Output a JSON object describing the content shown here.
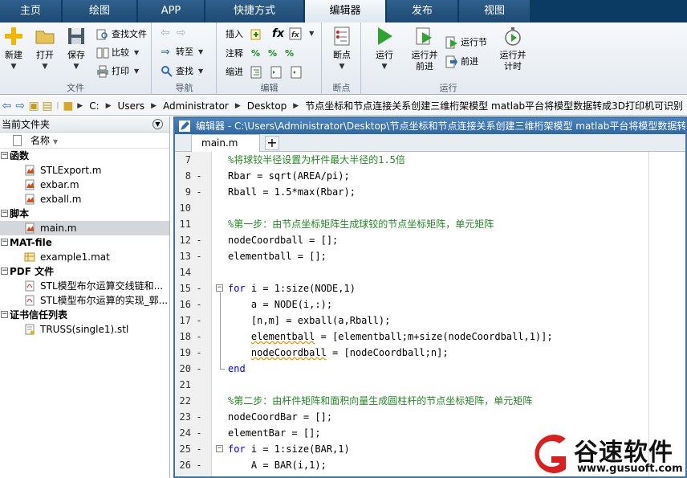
{
  "tabs": [
    {
      "label": "主页",
      "active": false
    },
    {
      "label": "绘图",
      "active": false
    },
    {
      "label": "APP",
      "active": false
    },
    {
      "label": "快捷方式",
      "active": false
    },
    {
      "label": "编辑器",
      "active": true
    },
    {
      "label": "发布",
      "active": false
    },
    {
      "label": "视图",
      "active": false
    }
  ],
  "ribbon": {
    "file": {
      "label": "文件",
      "new": "新建",
      "open": "打开",
      "save": "保存",
      "find_files": "查找文件",
      "compare": "比较",
      "print": "打印"
    },
    "navigate": {
      "label": "导航",
      "goto": "转至",
      "find": "查找"
    },
    "edit": {
      "label": "编辑",
      "insert": "插入",
      "comment": "注释",
      "indent": "缩进",
      "fx": "fx"
    },
    "breakpoints": {
      "label": "断点",
      "breakpoints": "断点"
    },
    "run": {
      "label": "运行",
      "run": "运行",
      "run_advance": "运行并\n前进",
      "run_section": "运行节",
      "advance": "前进",
      "run_time": "运行并\n计时"
    }
  },
  "address": {
    "drive": "C:",
    "segments": [
      "Users",
      "Administrator",
      "Desktop",
      "节点坐标和节点连接关系创建三维桁架模型 matlab平台将模型数据转成3D打印机可识别"
    ]
  },
  "left_panel": {
    "title": "当前文件夹",
    "column_name": "名称",
    "sections": [
      {
        "label": "函数",
        "items": [
          "STLExport.m",
          "exbar.m",
          "exball.m"
        ]
      },
      {
        "label": "脚本",
        "items": [
          "main.m"
        ]
      },
      {
        "label": "MAT-file",
        "items": [
          "example1.mat"
        ]
      },
      {
        "label": "PDF 文件",
        "items": [
          "STL模型布尔运算交线链和...",
          "STL模型布尔运算的实现_郭..."
        ]
      },
      {
        "label": "证书信任列表",
        "items": [
          "TRUSS(single1).stl"
        ]
      }
    ],
    "selected_item": "main.m"
  },
  "editor": {
    "title": "编辑器 - C:\\Users\\Administrator\\Desktop\\节点坐标和节点连接关系创建三维桁架模型 matlab平台将模型数据转成",
    "tab": "main.m",
    "add_tab": "+",
    "lines": [
      {
        "n": "7",
        "mark": "",
        "fold": "",
        "parts": [
          {
            "t": "%将球铰半径设置为杆件最大半径的1.5倍",
            "c": "cm"
          }
        ]
      },
      {
        "n": "8",
        "mark": "-",
        "fold": "",
        "parts": [
          {
            "t": "Rbar = sqrt(AREA/pi);",
            "c": ""
          }
        ]
      },
      {
        "n": "9",
        "mark": "-",
        "fold": "",
        "parts": [
          {
            "t": "Rball = 1.5*max(Rbar);",
            "c": ""
          }
        ]
      },
      {
        "n": "10",
        "mark": "",
        "fold": "",
        "parts": []
      },
      {
        "n": "11",
        "mark": "",
        "fold": "",
        "parts": [
          {
            "t": "%第一步：由节点坐标矩阵生成球铰的节点坐标矩阵，单元矩阵",
            "c": "cm"
          }
        ]
      },
      {
        "n": "12",
        "mark": "-",
        "fold": "",
        "parts": [
          {
            "t": "nodeCoordball = [];",
            "c": ""
          }
        ]
      },
      {
        "n": "13",
        "mark": "-",
        "fold": "",
        "parts": [
          {
            "t": "elementball = [];",
            "c": ""
          }
        ]
      },
      {
        "n": "14",
        "mark": "",
        "fold": "",
        "parts": []
      },
      {
        "n": "15",
        "mark": "-",
        "fold": "start",
        "parts": [
          {
            "t": "for",
            "c": "kw"
          },
          {
            "t": " i = 1:size(NODE,1)",
            "c": ""
          }
        ]
      },
      {
        "n": "16",
        "mark": "-",
        "fold": "",
        "parts": [
          {
            "t": "    a = NODE(i,:);",
            "c": ""
          }
        ]
      },
      {
        "n": "17",
        "mark": "-",
        "fold": "",
        "parts": [
          {
            "t": "    [n,m] = exball(a,Rball);",
            "c": ""
          }
        ]
      },
      {
        "n": "18",
        "mark": "-",
        "fold": "",
        "parts": [
          {
            "t": "    ",
            "c": ""
          },
          {
            "t": "elementball",
            "c": "ul"
          },
          {
            "t": " = [elementball;m+size(nodeCoordball,1)];",
            "c": ""
          }
        ]
      },
      {
        "n": "19",
        "mark": "-",
        "fold": "",
        "parts": [
          {
            "t": "    ",
            "c": ""
          },
          {
            "t": "nodeCoordball",
            "c": "ul"
          },
          {
            "t": " = [nodeCoordball;n];",
            "c": ""
          }
        ]
      },
      {
        "n": "20",
        "mark": "-",
        "fold": "end",
        "parts": [
          {
            "t": "end",
            "c": "kw"
          }
        ]
      },
      {
        "n": "21",
        "mark": "",
        "fold": "",
        "parts": []
      },
      {
        "n": "22",
        "mark": "",
        "fold": "",
        "parts": [
          {
            "t": "%第二步：由杆件矩阵和面积向量生成圆柱杆的节点坐标矩阵，单元矩阵",
            "c": "cm"
          }
        ]
      },
      {
        "n": "23",
        "mark": "-",
        "fold": "",
        "parts": [
          {
            "t": "nodeCoordBar = [];",
            "c": ""
          }
        ]
      },
      {
        "n": "24",
        "mark": "-",
        "fold": "",
        "parts": [
          {
            "t": "elementBar = [];",
            "c": ""
          }
        ]
      },
      {
        "n": "25",
        "mark": "-",
        "fold": "start",
        "parts": [
          {
            "t": "for",
            "c": "kw"
          },
          {
            "t": " i = 1:size(BAR,1)",
            "c": ""
          }
        ]
      },
      {
        "n": "26",
        "mark": "-",
        "fold": "",
        "parts": [
          {
            "t": "    A = BAR(i,1);",
            "c": ""
          }
        ]
      }
    ]
  },
  "watermark": {
    "name": "谷速软件",
    "url": "www.gusuoft.com"
  },
  "colors": {
    "tab_bar": "#0b3a63",
    "editor_title": "#3d74b0",
    "comment": "#228b22",
    "keyword": "#0000ff",
    "watermark_red": "#d9201f"
  }
}
